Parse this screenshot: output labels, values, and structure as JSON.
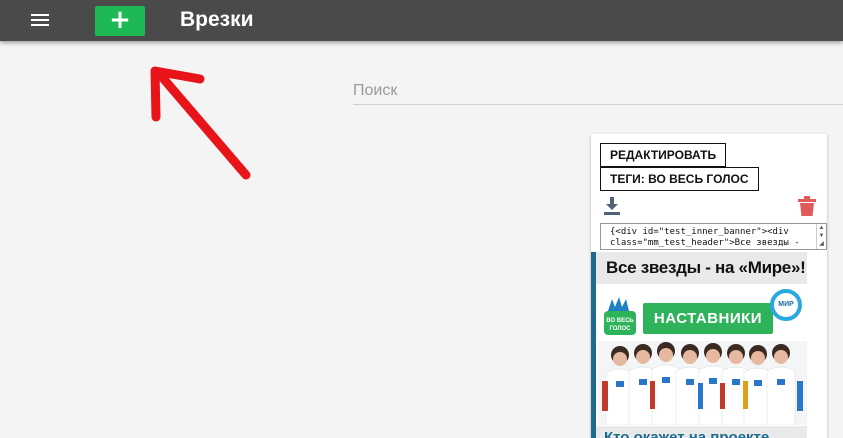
{
  "header": {
    "title": "Врезки",
    "add_label": "+",
    "menu_icon": "hamburger-menu-icon",
    "add_color": "#1db954",
    "bar_color": "#4a4a4a"
  },
  "search": {
    "placeholder": "Поиск",
    "value": ""
  },
  "card": {
    "edit_label": "РЕДАКТИРОВАТЬ",
    "tags_label": "ТЕГИ: ВО ВЕСЬ ГОЛОС",
    "download_icon": "download-icon",
    "delete_icon": "trash-icon",
    "delete_color": "#e05a5a",
    "code_value": "{<div id=\"test_inner_banner\"><div class=\"mm_test_header\">Все звезды -",
    "banner": {
      "headline": "Все звезды - на «Мире»!",
      "promo_label": "НАСТАВНИКИ",
      "show_logo_text": "ВО ВЕСЬ ГОЛОС",
      "channel_logo_text": "МИР",
      "subline": "Кто окажет на проекте",
      "accent_color": "#1d6b8d"
    }
  },
  "annotation": {
    "arrow_color": "#e8141a"
  }
}
